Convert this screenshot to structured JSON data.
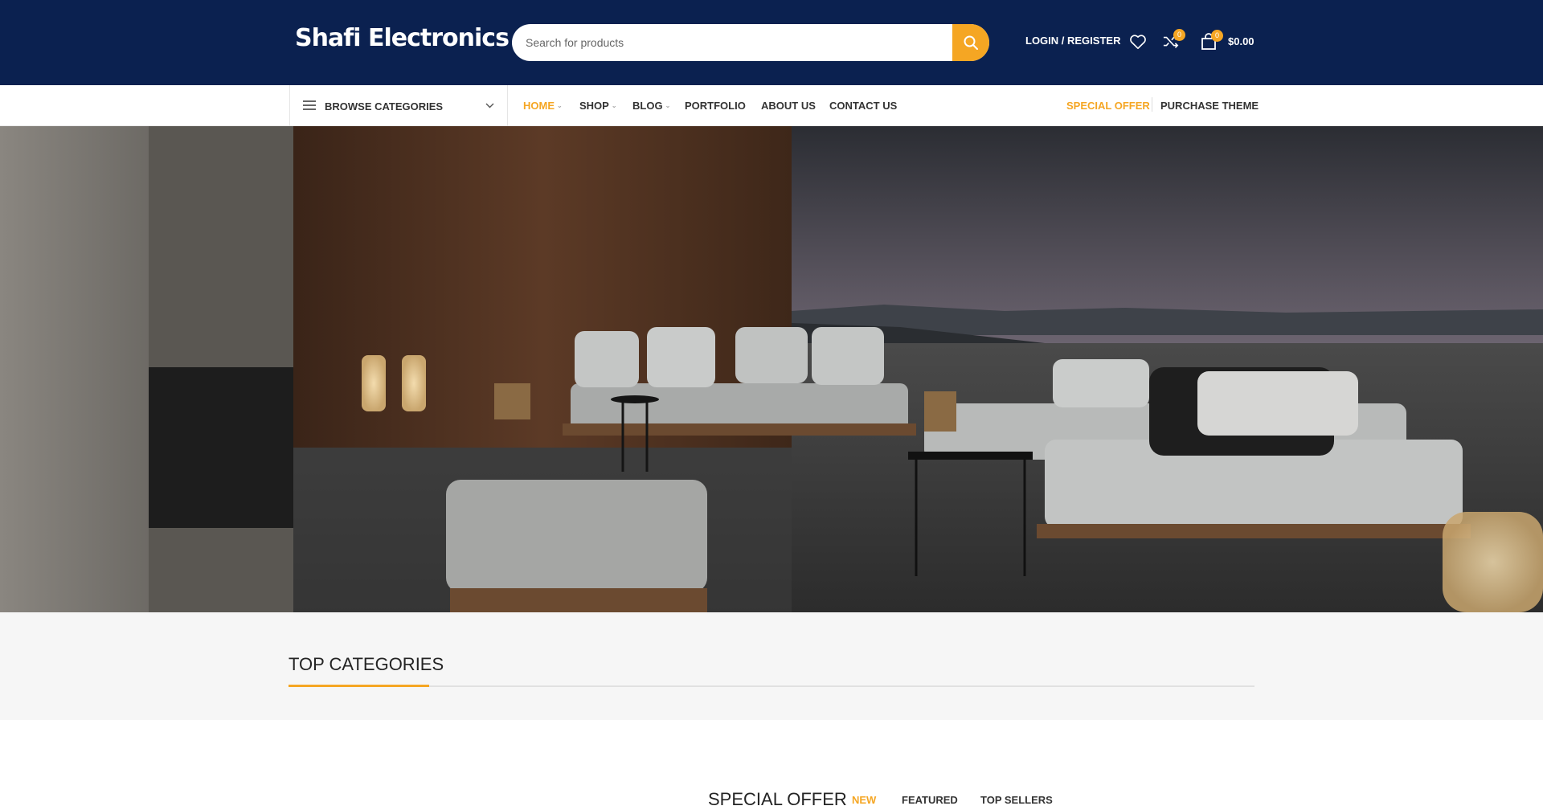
{
  "header": {
    "logo": "Shafi Electronics",
    "search_placeholder": "Search for products",
    "login_label": "LOGIN / REGISTER",
    "compare_count": "0",
    "cart_count": "0",
    "cart_total": "$0.00"
  },
  "nav": {
    "browse_label": "BROWSE CATEGORIES",
    "items": [
      {
        "label": "HOME",
        "active": true,
        "has_dropdown": true
      },
      {
        "label": "SHOP",
        "active": false,
        "has_dropdown": true
      },
      {
        "label": "BLOG",
        "active": false,
        "has_dropdown": true
      },
      {
        "label": "PORTFOLIO",
        "active": false,
        "has_dropdown": false
      },
      {
        "label": "ABOUT US",
        "active": false,
        "has_dropdown": false
      },
      {
        "label": "CONTACT US",
        "active": false,
        "has_dropdown": false
      }
    ],
    "special_offer": "SPECIAL OFFER",
    "purchase_theme": "PURCHASE THEME"
  },
  "top_categories": {
    "title": "TOP CATEGORIES"
  },
  "product_tabs": {
    "title": "SPECIAL OFFER",
    "tabs": [
      {
        "label": "NEW",
        "active": true
      },
      {
        "label": "FEATURED",
        "active": false
      },
      {
        "label": "TOP SELLERS",
        "active": false
      }
    ]
  },
  "colors": {
    "header_bg": "#0b2150",
    "accent": "#f5a623"
  }
}
